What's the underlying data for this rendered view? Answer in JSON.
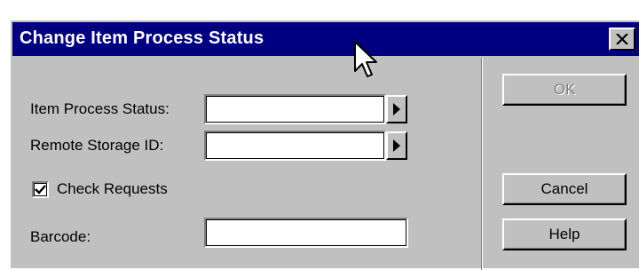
{
  "dialog": {
    "title": "Change Item Process Status",
    "close_icon": "close-x-icon"
  },
  "fields": {
    "item_process_status": {
      "label": "Item Process Status:",
      "value": ""
    },
    "remote_storage_id": {
      "label": "Remote Storage ID:",
      "value": ""
    },
    "barcode": {
      "label": "Barcode:",
      "value": ""
    }
  },
  "check_requests": {
    "label": "Check Requests",
    "checked": true
  },
  "buttons": {
    "ok": "OK",
    "cancel": "Cancel",
    "help": "Help"
  },
  "colors": {
    "titlebar": "#000080",
    "dialog_bg": "#c0c0c0"
  }
}
